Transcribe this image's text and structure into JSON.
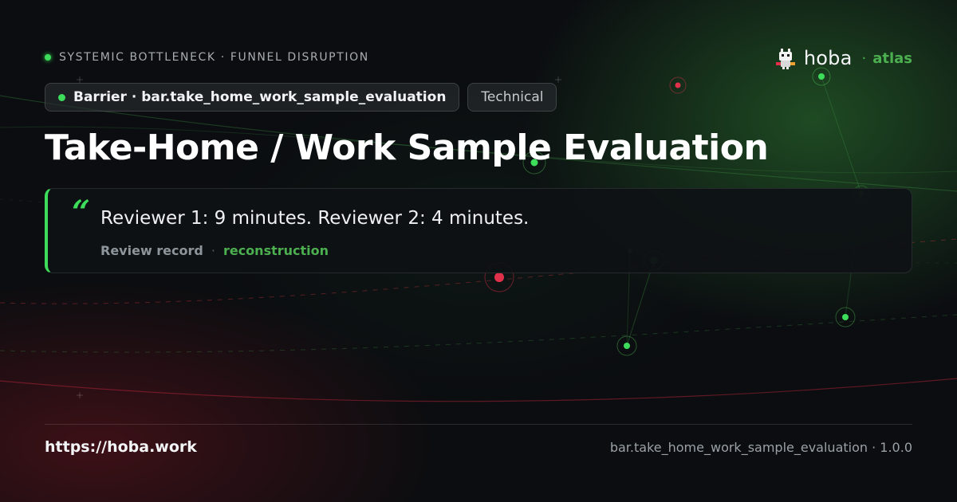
{
  "header": {
    "eyebrow": "SYSTEMIC BOTTLENECK · FUNNEL DISRUPTION",
    "brand_name": "hoba",
    "brand_separator": "·",
    "brand_sub": "atlas"
  },
  "chips": {
    "primary": "Barrier · bar.take_home_work_sample_evaluation",
    "secondary": "Technical"
  },
  "title": "Take-Home / Work Sample Evaluation",
  "quote": {
    "mark": "“",
    "text": "Reviewer 1: 9 minutes. Reviewer 2: 4 minutes.",
    "source": "Review record",
    "separator": "·",
    "tag": "reconstruction"
  },
  "footer": {
    "url": "https://hoba.work",
    "ref": "bar.take_home_work_sample_evaluation · 1.0.0"
  },
  "colors": {
    "accent_green": "#3ddc5a",
    "accent_red": "#e0304a",
    "background": "#0b0d10"
  },
  "icons": {
    "brand_logo": "robot-mascot-icon",
    "status_dot": "green-dot-icon"
  }
}
